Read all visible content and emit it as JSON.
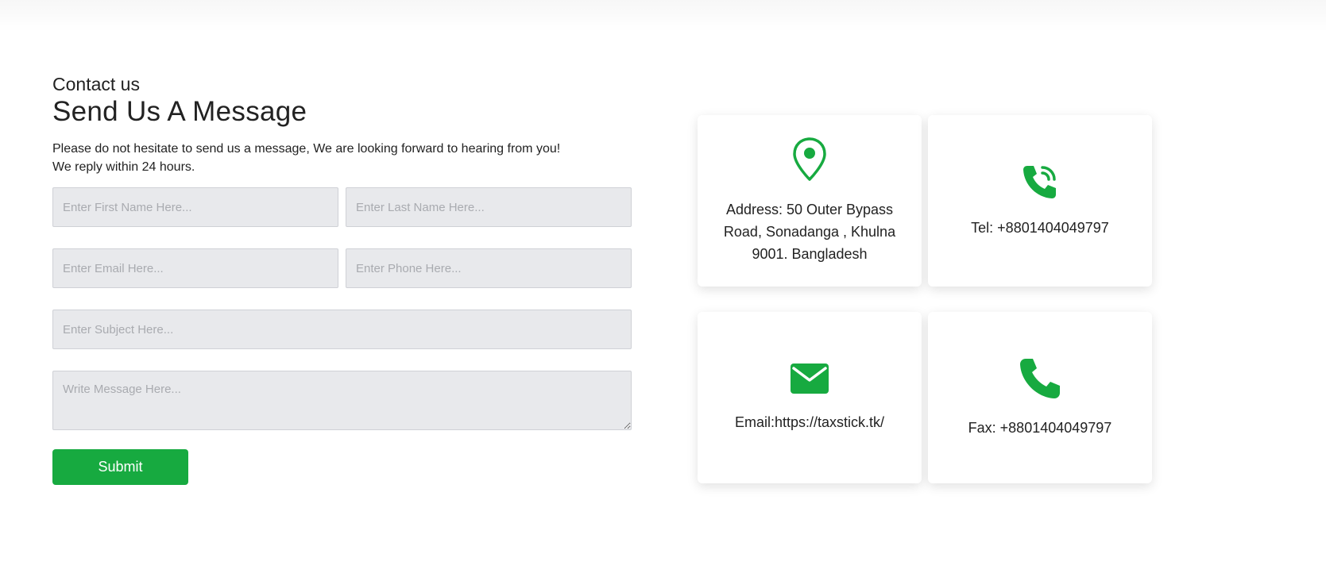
{
  "section": {
    "eyebrow": "Contact us",
    "title": "Send Us A Message",
    "intro_line1": "Please do not hesitate to send us a message, We are looking forward to hearing from you!",
    "intro_line2": "We reply within 24 hours."
  },
  "form": {
    "first_name_placeholder": "Enter First Name Here...",
    "last_name_placeholder": "Enter Last Name Here...",
    "email_placeholder": "Enter Email Here...",
    "phone_placeholder": "Enter Phone Here...",
    "subject_placeholder": "Enter Subject Here...",
    "message_placeholder": "Write Message Here...",
    "submit_label": "Submit"
  },
  "cards": {
    "address": {
      "icon": "map-pin-icon",
      "text": "Address: 50 Outer Bypass Road, Sonadanga , Khulna 9001. Bangladesh"
    },
    "tel": {
      "icon": "phone-ringing-icon",
      "text": "Tel: +8801404049797"
    },
    "email": {
      "icon": "envelope-icon",
      "text": "Email:https://taxstick.tk/"
    },
    "fax": {
      "icon": "phone-icon",
      "text": "Fax: +8801404049797"
    }
  },
  "colors": {
    "accent": "#17aa40",
    "field_bg": "#e8e9ec"
  }
}
